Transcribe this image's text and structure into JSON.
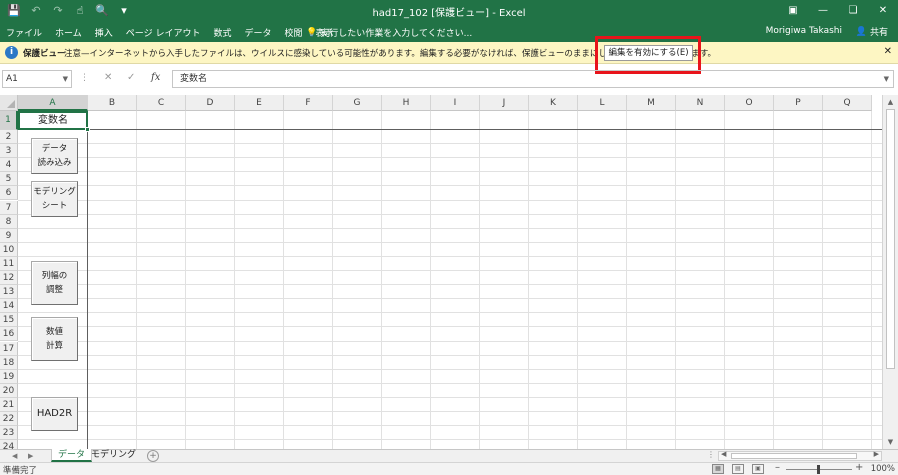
{
  "titlebar": {
    "title": "had17_102  [保護ビュー] - Excel",
    "qat_icons": [
      "save-icon",
      "undo-icon",
      "redo-icon",
      "touch-mode-icon",
      "print-preview-icon",
      "customize-qat-icon"
    ],
    "window_controls": [
      "ribbon-display-icon",
      "minimize-icon",
      "restore-icon",
      "close-icon"
    ]
  },
  "ribbon": {
    "tabs": [
      "ファイル",
      "ホーム",
      "挿入",
      "ページ レイアウト",
      "数式",
      "データ",
      "校閲",
      "表示"
    ],
    "tell_me": "実行したい作業を入力してください...",
    "user": "Morigiwa Takashi",
    "share": "共有"
  },
  "message_bar": {
    "label": "保護ビュー",
    "message": "注意—インターネットから入手したファイルは、ウイルスに感染している可能性があります。編集する必要がなければ、保護ビューのままにしておくことをお勧めします。",
    "enable_button": "編集を有効にする(E)",
    "highlight_color": "#e8141b"
  },
  "formula_bar": {
    "name_box": "A1",
    "content": "変数名",
    "fx": "fx"
  },
  "grid": {
    "columns": [
      "A",
      "B",
      "C",
      "D",
      "E",
      "F",
      "G",
      "H",
      "I",
      "J",
      "K",
      "L",
      "M",
      "N",
      "O",
      "P",
      "Q"
    ],
    "rows": [
      "1",
      "2",
      "3",
      "4",
      "5",
      "6",
      "7",
      "8",
      "9",
      "10",
      "11",
      "12",
      "13",
      "14",
      "15",
      "16",
      "17",
      "18",
      "19",
      "20",
      "21",
      "22",
      "23",
      "24"
    ],
    "selected_column": "A",
    "selected_row": "1",
    "a1_value": "変数名"
  },
  "macro_buttons": [
    {
      "line1": "データ",
      "line2": "読み込み"
    },
    {
      "line1": "モデリング",
      "line2": "シート"
    },
    {
      "line1": "列幅の",
      "line2": "調整"
    },
    {
      "line1": "数値",
      "line2": "計算"
    },
    {
      "line1": "HAD2R",
      "line2": ""
    }
  ],
  "sheet_tabs": {
    "tabs": [
      "データ",
      "モデリング"
    ],
    "active": "データ",
    "add_sheet": "⊕"
  },
  "status_bar": {
    "status": "準備完了",
    "zoom": "100%"
  },
  "accent_color": "#217346"
}
